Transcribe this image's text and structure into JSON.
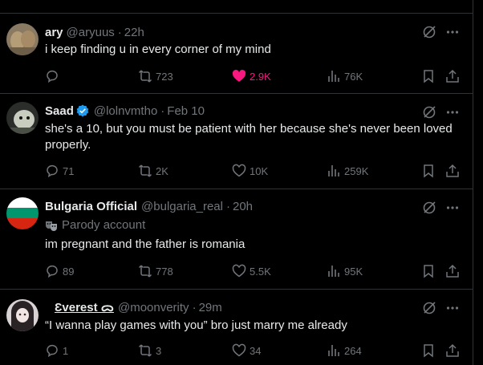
{
  "tweets": [
    {
      "name": "ary",
      "handle": "@aryuus",
      "time": "22h",
      "text": "i keep finding u in every corner of my mind",
      "replies": "",
      "retweets": "723",
      "likes": "2.9K",
      "views": "76K",
      "liked": true
    },
    {
      "name": "Saad",
      "handle": "@lolnvmtho",
      "time": "Feb 10",
      "text": "she's a 10, but you must be patient with her because she's never been loved properly.",
      "replies": "71",
      "retweets": "2K",
      "likes": "10K",
      "views": "259K",
      "verified": true
    },
    {
      "name": "Bulgaria Official",
      "handle": "@bulgaria_real",
      "time": "20h",
      "parody": "Parody account",
      "text": "im pregnant and the father is romania",
      "replies": "89",
      "retweets": "778",
      "likes": "5.5K",
      "views": "95K"
    },
    {
      "name": "Ɛverest ᯅ",
      "handle": "@moonverity",
      "time": "29m",
      "text": "“I wanna play games with you” bro just marry me already",
      "replies": "1",
      "retweets": "3",
      "likes": "34",
      "views": "264"
    }
  ],
  "separator": "·",
  "colors": {
    "background": "#000000",
    "divider": "#2f3336",
    "muted": "#71767b",
    "like": "#f91880",
    "verified": "#1d9bf0"
  }
}
